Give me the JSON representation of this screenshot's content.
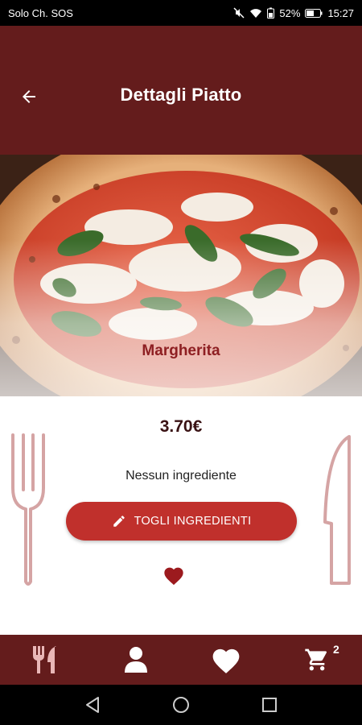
{
  "status_bar": {
    "carrier": "Solo Ch. SOS",
    "battery": "52%",
    "time": "15:27"
  },
  "header": {
    "title": "Dettagli Piatto",
    "back_icon": "arrow-back-icon"
  },
  "dish": {
    "name": "Margherita",
    "price": "3.70€",
    "ingredients_text": "Nessun ingrediente",
    "remove_button_label": "TOGLI INGREDIENTI",
    "remove_button_icon": "pencil-icon",
    "favorite_icon": "heart-icon"
  },
  "bottom_nav": {
    "items": [
      {
        "icon": "fork-knife-icon"
      },
      {
        "icon": "user-icon"
      },
      {
        "icon": "heart-icon"
      },
      {
        "icon": "cart-icon",
        "badge": "2"
      }
    ]
  },
  "colors": {
    "primary_dark": "#641c1c",
    "button": "#c0302c",
    "dish_name": "#8e1f22",
    "cutlery_outline": "#d5a4a4"
  }
}
